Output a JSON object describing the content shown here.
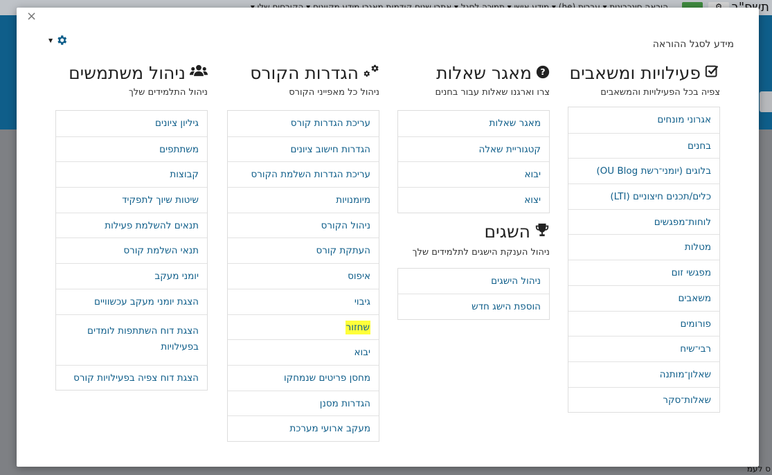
{
  "background": {
    "topnav_text": "הוראה סינכרונית ▾   עברית (he) ▾   מידע אישי ▾   תמיכה לסגל ▾   אתרי שנים קודמות   מאגרי מידע מקוונים ▾   הקורסים שלי ▾",
    "brand": "תשפ\"ב",
    "bottom_text": "ס לעמ"
  },
  "modal": {
    "title": "מידע לסגל ההוראה",
    "close_symbol": "×"
  },
  "sections": {
    "activities": {
      "title": "פעילויות ומשאבים",
      "subtitle": "צפיה בכל הפעילויות והמשאבים",
      "items": [
        "אגרוני מונחים",
        "בחנים",
        "בלוגים (יומני־רשת OU Blog)",
        "כלים/תכנים חיצוניים (LTI)",
        "לוחות־מפגשים",
        "מטלות",
        "מפגשי זום",
        "משאבים",
        "פורומים",
        "רבי־שיח",
        "שאלון־מותנה",
        "שאלות־סקר"
      ]
    },
    "questions": {
      "title": "מאגר שאלות",
      "subtitle": "צרו וארגנו שאלות עבור בחנים",
      "items": [
        "מאגר שאלות",
        "קטגוריית שאלה",
        "יבוא",
        "יצוא"
      ]
    },
    "badges": {
      "title": "השגים",
      "subtitle": "ניהול הענקת הישגים לתלמידים שלך",
      "items": [
        "ניהול הישגים",
        "הוספת הישג חדש"
      ]
    },
    "course": {
      "title": "הגדרות הקורס",
      "subtitle": "ניהול כל מאפייני הקורס",
      "items": [
        "עריכת הגדרות קורס",
        "הגדרות חישוב ציונים",
        "עריכת הגדרות השלמת הקורס",
        "מיומנויות",
        "ניהול הקורס",
        "העתקת קורס",
        "איפוס",
        "גיבוי",
        "שחזור",
        "יבוא",
        "מחסן פריטים שנמחקו",
        "הגדרות מסנן",
        "מעקב ארועי מערכת"
      ],
      "highlighted": "שחזור"
    },
    "users": {
      "title": "ניהול משתמשים",
      "subtitle": "ניהול התלמידים שלך",
      "items": [
        "גיליון ציונים",
        "משתתפים",
        "קבוצות",
        "שיטות שיוך לתפקיד",
        "תנאים להשלמת פעילות",
        "תנאי השלמת קורס",
        "יומני מעקב",
        "הצגת יומני מעקב עכשוויים",
        "הצגת דוח השתתפות לומדים בפעילויות",
        "הצגת דוח צפיה בפעילויות קורס"
      ]
    }
  },
  "colors": {
    "link": "#0f5e8a",
    "highlight": "#ffff3a",
    "header_blue": "#0f5e8a"
  }
}
